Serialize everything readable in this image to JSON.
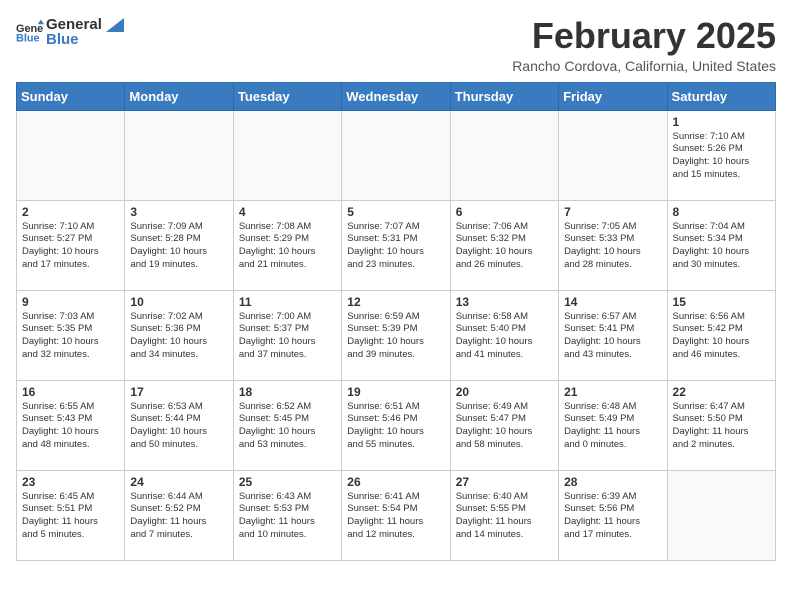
{
  "header": {
    "logo_line1": "General",
    "logo_line2": "Blue",
    "month_year": "February 2025",
    "location": "Rancho Cordova, California, United States"
  },
  "weekdays": [
    "Sunday",
    "Monday",
    "Tuesday",
    "Wednesday",
    "Thursday",
    "Friday",
    "Saturday"
  ],
  "weeks": [
    [
      {
        "day": "",
        "info": ""
      },
      {
        "day": "",
        "info": ""
      },
      {
        "day": "",
        "info": ""
      },
      {
        "day": "",
        "info": ""
      },
      {
        "day": "",
        "info": ""
      },
      {
        "day": "",
        "info": ""
      },
      {
        "day": "1",
        "info": "Sunrise: 7:10 AM\nSunset: 5:26 PM\nDaylight: 10 hours\nand 15 minutes."
      }
    ],
    [
      {
        "day": "2",
        "info": "Sunrise: 7:10 AM\nSunset: 5:27 PM\nDaylight: 10 hours\nand 17 minutes."
      },
      {
        "day": "3",
        "info": "Sunrise: 7:09 AM\nSunset: 5:28 PM\nDaylight: 10 hours\nand 19 minutes."
      },
      {
        "day": "4",
        "info": "Sunrise: 7:08 AM\nSunset: 5:29 PM\nDaylight: 10 hours\nand 21 minutes."
      },
      {
        "day": "5",
        "info": "Sunrise: 7:07 AM\nSunset: 5:31 PM\nDaylight: 10 hours\nand 23 minutes."
      },
      {
        "day": "6",
        "info": "Sunrise: 7:06 AM\nSunset: 5:32 PM\nDaylight: 10 hours\nand 26 minutes."
      },
      {
        "day": "7",
        "info": "Sunrise: 7:05 AM\nSunset: 5:33 PM\nDaylight: 10 hours\nand 28 minutes."
      },
      {
        "day": "8",
        "info": "Sunrise: 7:04 AM\nSunset: 5:34 PM\nDaylight: 10 hours\nand 30 minutes."
      }
    ],
    [
      {
        "day": "9",
        "info": "Sunrise: 7:03 AM\nSunset: 5:35 PM\nDaylight: 10 hours\nand 32 minutes."
      },
      {
        "day": "10",
        "info": "Sunrise: 7:02 AM\nSunset: 5:36 PM\nDaylight: 10 hours\nand 34 minutes."
      },
      {
        "day": "11",
        "info": "Sunrise: 7:00 AM\nSunset: 5:37 PM\nDaylight: 10 hours\nand 37 minutes."
      },
      {
        "day": "12",
        "info": "Sunrise: 6:59 AM\nSunset: 5:39 PM\nDaylight: 10 hours\nand 39 minutes."
      },
      {
        "day": "13",
        "info": "Sunrise: 6:58 AM\nSunset: 5:40 PM\nDaylight: 10 hours\nand 41 minutes."
      },
      {
        "day": "14",
        "info": "Sunrise: 6:57 AM\nSunset: 5:41 PM\nDaylight: 10 hours\nand 43 minutes."
      },
      {
        "day": "15",
        "info": "Sunrise: 6:56 AM\nSunset: 5:42 PM\nDaylight: 10 hours\nand 46 minutes."
      }
    ],
    [
      {
        "day": "16",
        "info": "Sunrise: 6:55 AM\nSunset: 5:43 PM\nDaylight: 10 hours\nand 48 minutes."
      },
      {
        "day": "17",
        "info": "Sunrise: 6:53 AM\nSunset: 5:44 PM\nDaylight: 10 hours\nand 50 minutes."
      },
      {
        "day": "18",
        "info": "Sunrise: 6:52 AM\nSunset: 5:45 PM\nDaylight: 10 hours\nand 53 minutes."
      },
      {
        "day": "19",
        "info": "Sunrise: 6:51 AM\nSunset: 5:46 PM\nDaylight: 10 hours\nand 55 minutes."
      },
      {
        "day": "20",
        "info": "Sunrise: 6:49 AM\nSunset: 5:47 PM\nDaylight: 10 hours\nand 58 minutes."
      },
      {
        "day": "21",
        "info": "Sunrise: 6:48 AM\nSunset: 5:49 PM\nDaylight: 11 hours\nand 0 minutes."
      },
      {
        "day": "22",
        "info": "Sunrise: 6:47 AM\nSunset: 5:50 PM\nDaylight: 11 hours\nand 2 minutes."
      }
    ],
    [
      {
        "day": "23",
        "info": "Sunrise: 6:45 AM\nSunset: 5:51 PM\nDaylight: 11 hours\nand 5 minutes."
      },
      {
        "day": "24",
        "info": "Sunrise: 6:44 AM\nSunset: 5:52 PM\nDaylight: 11 hours\nand 7 minutes."
      },
      {
        "day": "25",
        "info": "Sunrise: 6:43 AM\nSunset: 5:53 PM\nDaylight: 11 hours\nand 10 minutes."
      },
      {
        "day": "26",
        "info": "Sunrise: 6:41 AM\nSunset: 5:54 PM\nDaylight: 11 hours\nand 12 minutes."
      },
      {
        "day": "27",
        "info": "Sunrise: 6:40 AM\nSunset: 5:55 PM\nDaylight: 11 hours\nand 14 minutes."
      },
      {
        "day": "28",
        "info": "Sunrise: 6:39 AM\nSunset: 5:56 PM\nDaylight: 11 hours\nand 17 minutes."
      },
      {
        "day": "",
        "info": ""
      }
    ]
  ]
}
